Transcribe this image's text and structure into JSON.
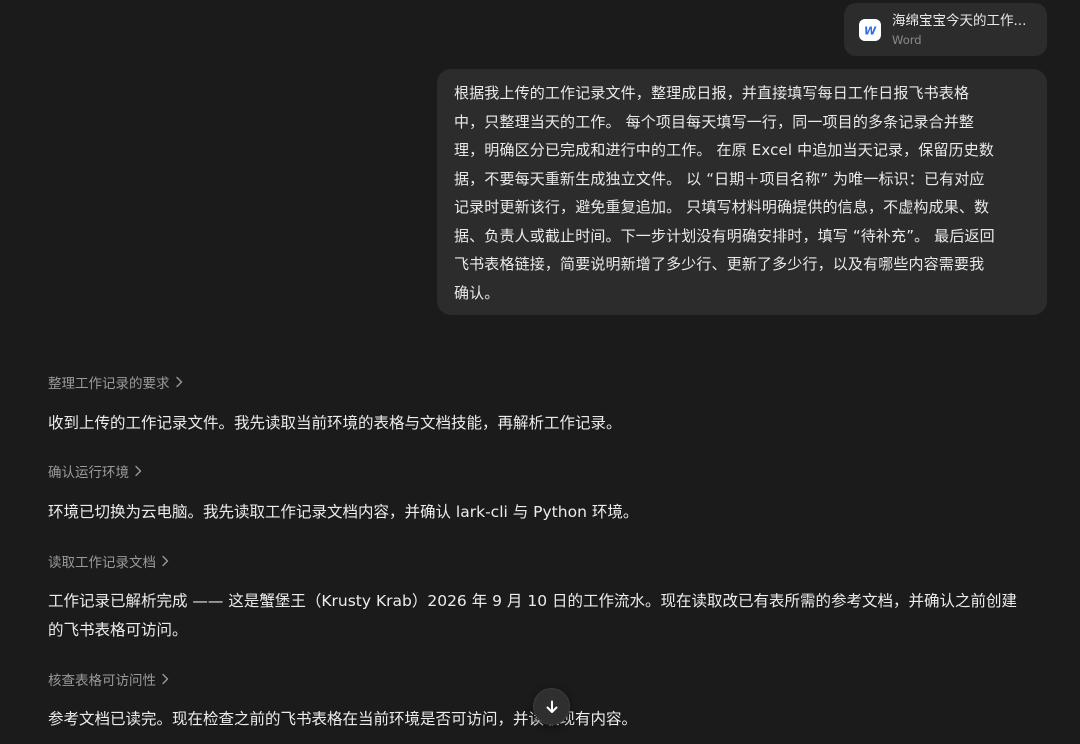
{
  "attachment": {
    "file_name": "海绵宝宝今天的工作...",
    "file_type": "Word",
    "icon": "word-doc-icon"
  },
  "user_message": {
    "lines": [
      "根据我上传的工作记录文件，整理成日报，并直接填写每日工作日报飞书表格",
      "中，只整理当天的工作。 每个项目每天填写一行，同一项目的多条记录合并整",
      "理，明确区分已完成和进行中的工作。 在原 Excel 中追加当天记录，保留历史数",
      "据，不要每天重新生成独立文件。 以 “日期＋项目名称” 为唯一标识：已有对应",
      "记录时更新该行，避免重复追加。 只填写材料明确提供的信息，不虚构成果、数",
      "据、负责人或截止时间。下一步计划没有明确安排时，填写 “待补充”。 最后返回",
      "飞书表格链接，简要说明新增了多少行、更新了多少行，以及有哪些内容需要我",
      "确认。"
    ]
  },
  "steps": [
    {
      "label": "整理工作记录的要求",
      "reply_lines": [
        "收到上传的工作记录文件。我先读取当前环境的表格与文档技能，再解析工作记录。"
      ]
    },
    {
      "label": "确认运行环境",
      "reply_lines": [
        "环境已切换为云电脑。我先读取工作记录文档内容，并确认 lark-cli 与 Python 环境。"
      ]
    },
    {
      "label": "读取工作记录文档",
      "reply_lines": [
        "工作记录已解析完成 —— 这是蟹堡王（Krusty Krab）2026 年 9 月 10 日的工作流水。现在读取改已有表所需的参考文档，并确认之前创建",
        "的飞书表格可访问。"
      ]
    },
    {
      "label": "核查表格可访问性",
      "reply_lines": [
        "参考文档已读完。现在检查之前的飞书表格在当前环境是否可访问，并读取现有内容。"
      ]
    }
  ],
  "icons": {
    "step_chevron": "chevron-right-icon",
    "scroll_button": "arrow-down-icon"
  }
}
